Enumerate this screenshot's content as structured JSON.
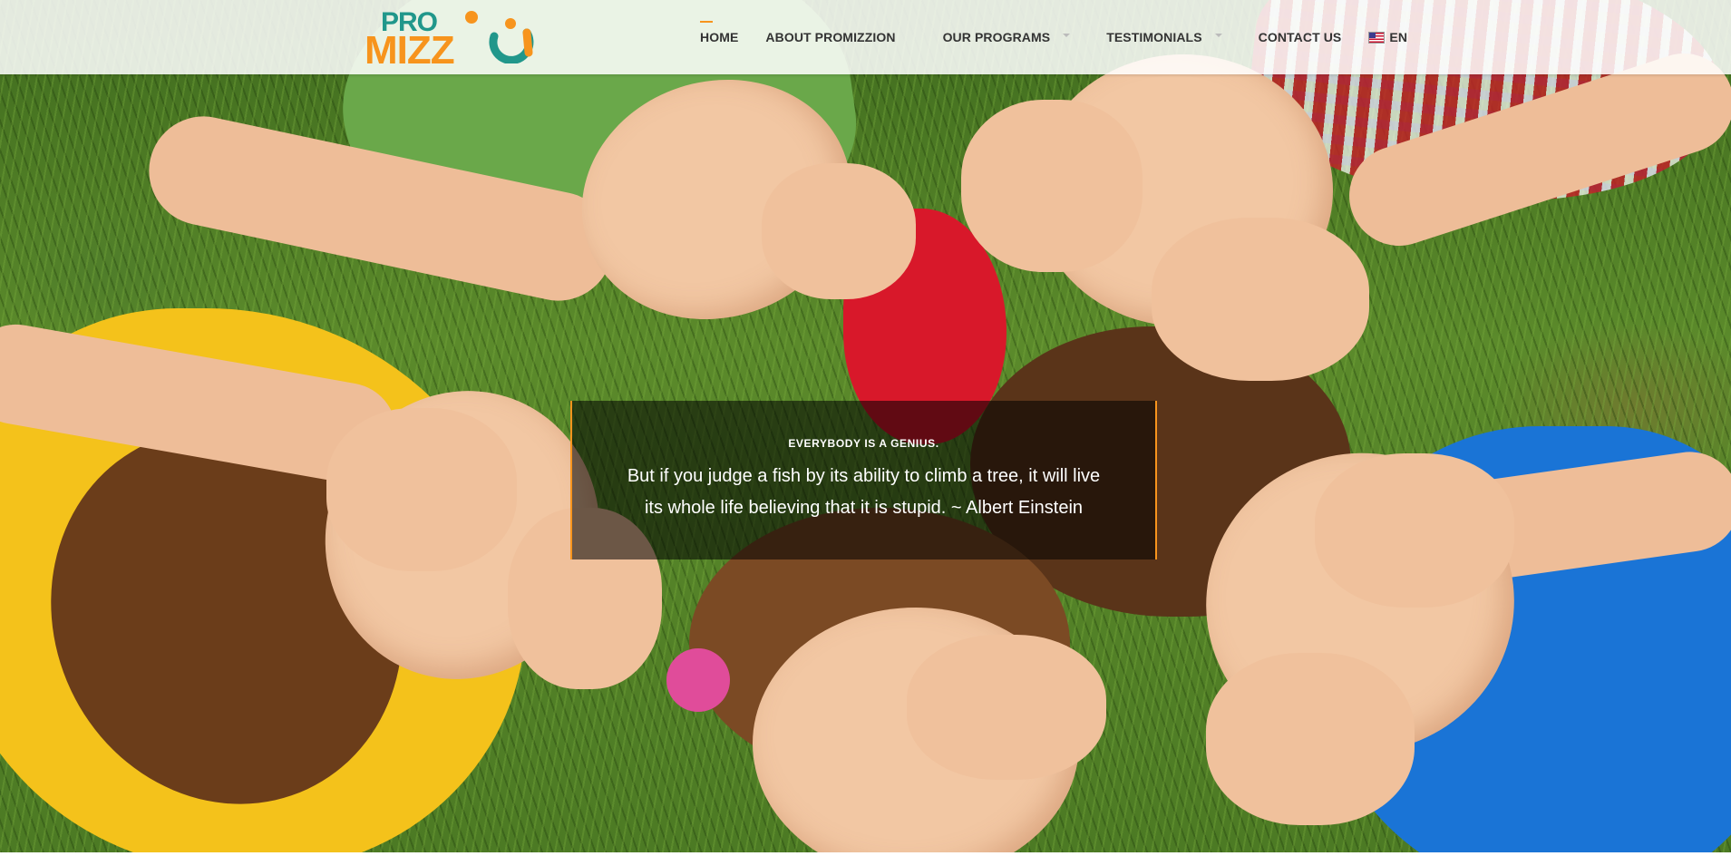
{
  "brand": {
    "logo_top": "PRO",
    "logo_bottom": "MIZZ",
    "colors": {
      "teal": "#21978b",
      "orange": "#f7941d"
    }
  },
  "nav": {
    "items": [
      {
        "label": "HOME",
        "active": true,
        "dropdown": false
      },
      {
        "label": "ABOUT PROMIZZION",
        "active": false,
        "dropdown": false
      },
      {
        "label": "OUR PROGRAMS",
        "active": false,
        "dropdown": true
      },
      {
        "label": "TESTIMONIALS",
        "active": false,
        "dropdown": true
      },
      {
        "label": "CONTACT US",
        "active": false,
        "dropdown": false
      }
    ],
    "language": {
      "label": "EN",
      "icon": "us-flag-icon"
    }
  },
  "hero": {
    "quote_heading": "EVERYBODY IS A GENIUS.",
    "quote_text": "But if you judge a fish by its ability to climb a tree, it will live its whole life believing that it is stupid. ~ Albert Einstein"
  }
}
